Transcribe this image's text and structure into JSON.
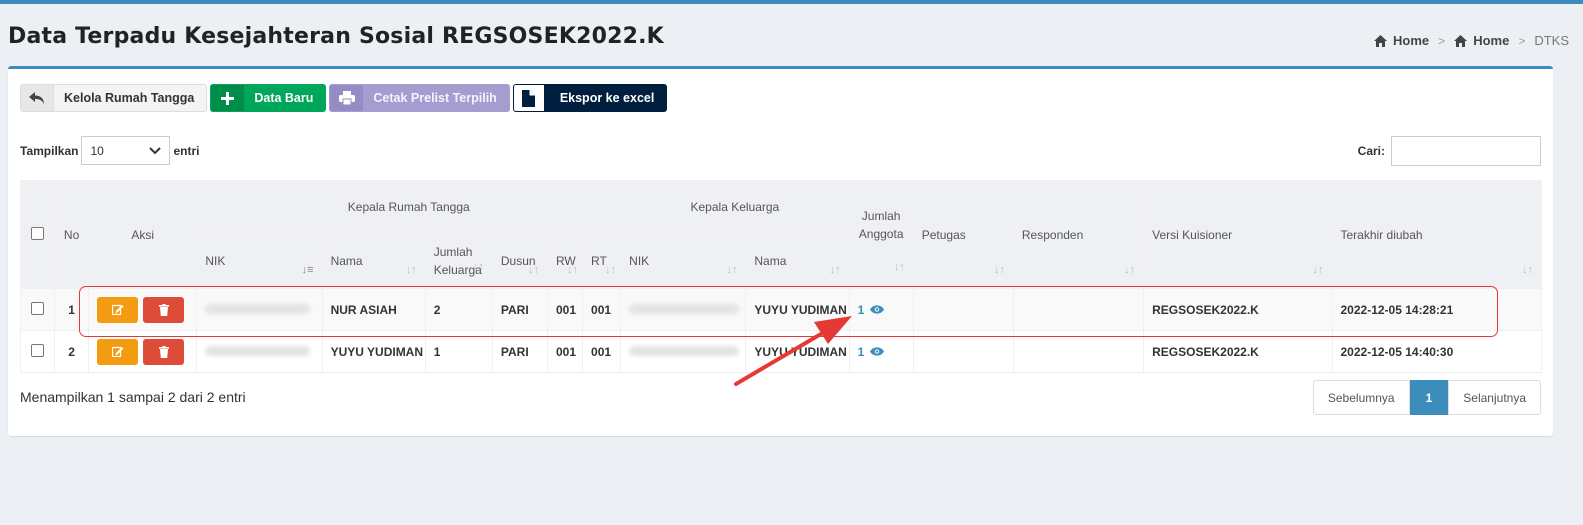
{
  "page": {
    "title": "Data Terpadu Kesejahteran Sosial REGSOSEK2022.K",
    "breadcrumb": [
      "Home",
      "Home",
      "DTKS"
    ]
  },
  "toolbar": {
    "back_label": "Kelola Rumah Tangga",
    "new_label": "Data Baru",
    "print_label": "Cetak Prelist Terpilih",
    "export_label": "Ekspor ke excel"
  },
  "length_menu": {
    "prefix": "Tampilkan",
    "value": "10",
    "suffix": "entri"
  },
  "search": {
    "label": "Cari:",
    "value": ""
  },
  "table": {
    "group_headers": {
      "kepala_rumah_tangga": "Kepala Rumah Tangga",
      "kepala_keluarga": "Kepala Keluarga"
    },
    "headers": {
      "no": "No",
      "aksi": "Aksi",
      "krt_nik": "NIK",
      "krt_nama": "Nama",
      "jumlah_keluarga": "Jumlah Keluarga",
      "dusun": "Dusun",
      "rw": "RW",
      "rt": "RT",
      "kk_nik": "NIK",
      "kk_nama": "Nama",
      "jumlah_anggota": "Jumlah Anggota",
      "petugas": "Petugas",
      "responden": "Responden",
      "versi": "Versi Kuisioner",
      "terakhir": "Terakhir diubah"
    },
    "rows": [
      {
        "no": "1",
        "krt_nama": "NUR ASIAH",
        "jumlah_keluarga": "2",
        "dusun": "PARI",
        "rw": "001",
        "rt": "001",
        "kk_nama": "YUYU YUDIMAN",
        "jumlah_anggota": "1",
        "petugas": "",
        "responden": "",
        "versi": "REGSOSEK2022.K",
        "terakhir": "2022-12-05 14:28:21"
      },
      {
        "no": "2",
        "krt_nama": "YUYU YUDIMAN",
        "jumlah_keluarga": "1",
        "dusun": "PARI",
        "rw": "001",
        "rt": "001",
        "kk_nama": "YUYU YUDIMAN",
        "jumlah_anggota": "1",
        "petugas": "",
        "responden": "",
        "versi": "REGSOSEK2022.K",
        "terakhir": "2022-12-05 14:40:30"
      }
    ]
  },
  "footer": {
    "info": "Menampilkan 1 sampai 2 dari 2 entri",
    "prev": "Sebelumnya",
    "current": "1",
    "next": "Selanjutnya"
  },
  "colors": {
    "primary": "#3c8dbc",
    "success": "#00a65a",
    "warning": "#f39c12",
    "danger": "#dd4b39",
    "annotation": "#e53935"
  }
}
